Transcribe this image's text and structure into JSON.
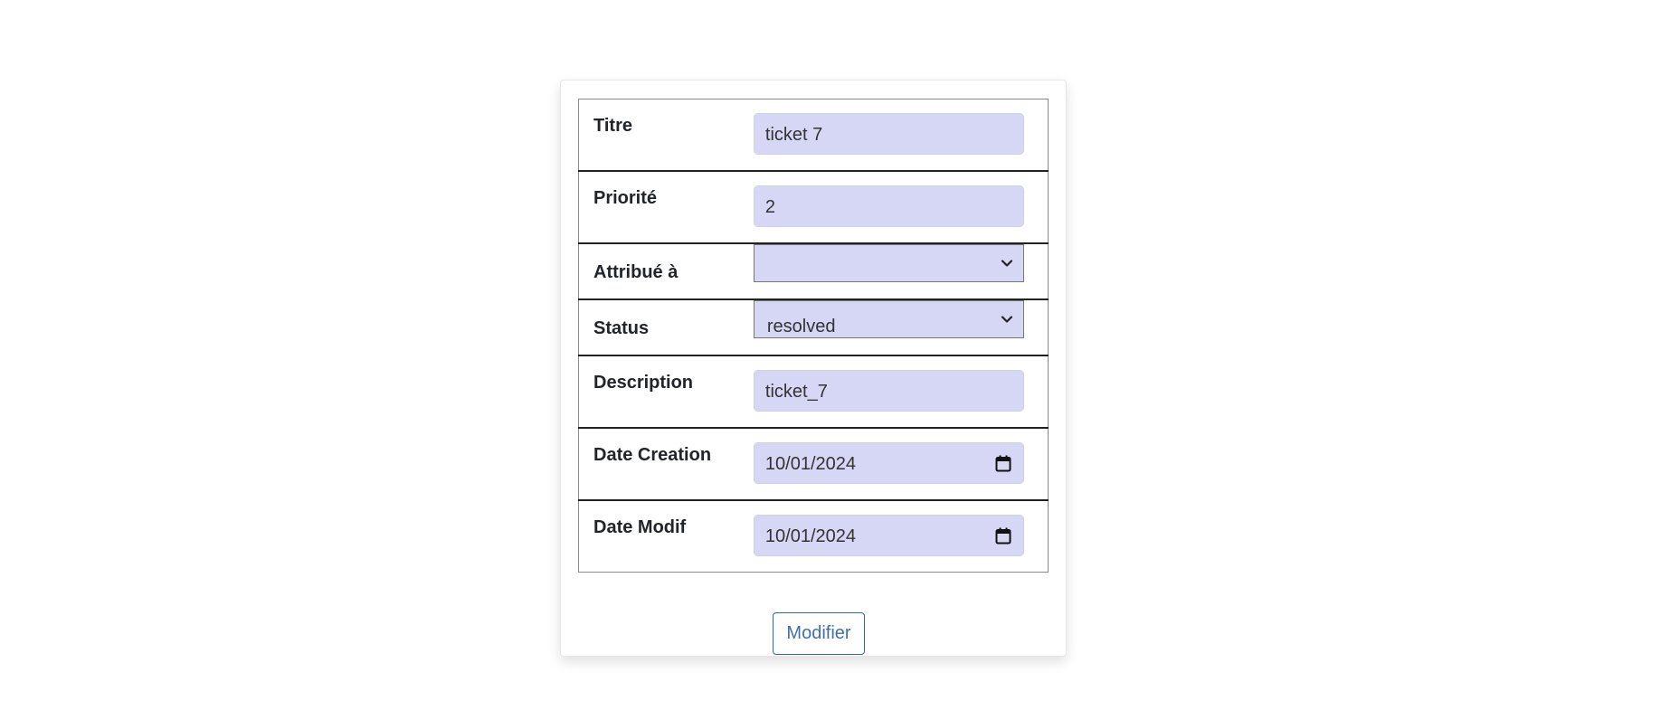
{
  "form": {
    "rows": [
      {
        "label": "Titre",
        "value": "ticket 7"
      },
      {
        "label": "Priorité",
        "value": "2"
      },
      {
        "label": "Attribué à",
        "value": ""
      },
      {
        "label": "Status",
        "value": "resolved"
      },
      {
        "label": "Description",
        "value": "ticket_7"
      },
      {
        "label": "Date Creation",
        "value": "10/01/2024"
      },
      {
        "label": "Date Modif",
        "value": "10/01/2024"
      }
    ],
    "submit_label": "Modifier"
  },
  "colors": {
    "field_background": "#d6d6f5",
    "button_border": "#2f66b3",
    "button_text": "#3f6fae"
  },
  "icons": [
    "chevron-down-icon",
    "calendar-icon"
  ]
}
